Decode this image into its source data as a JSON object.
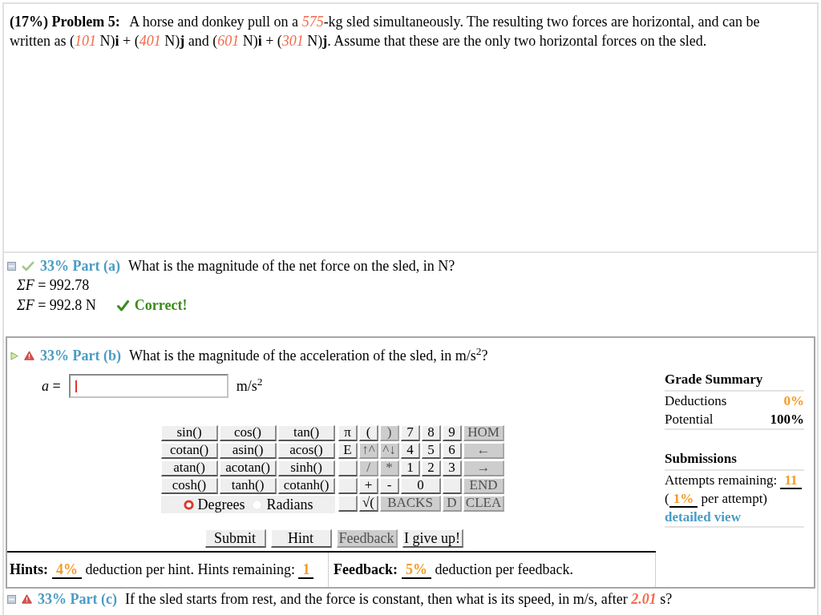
{
  "problem": {
    "statement": "**(17%) Problem 5:** A horse and donkey pull on a *575*-kg sled simultaneously. The resulting two forces are horizontal, and can be written as (*101* N)**i** + (*401* N)**j** and (*601* N)**i** + (*301* N)**j**. Assume that these are the only two horizontal forces on the sled."
  },
  "parts": [
    {
      "selected": false,
      "correct": true,
      "label": "33% Part (a)",
      "question": "What is the magnitude of the net force on the sled, in N?",
      "entered": "*ΣF* = 992.78",
      "answer": "*ΣF* = 992.8 N",
      "result": "Correct!"
    },
    {
      "selected": true,
      "correct": false,
      "label": "33% Part (b)",
      "question": "What is the magnitude of the acceleration of the sled, in m/s$^{2}$?",
      "answer_field": {
        "label": "*a* =",
        "unit": "m/s$^{2}$",
        "focused": true
      },
      "calculator": {
        "functions": [
          {
            "label": "sin()"
          },
          {
            "label": "cos()"
          },
          {
            "label": "tan()"
          },
          {
            "label": "cotan()"
          },
          {
            "label": "asin()"
          },
          {
            "label": "acos()"
          },
          {
            "label": "atan()"
          },
          {
            "label": "acotan()"
          },
          {
            "label": "sinh()"
          },
          {
            "label": "cosh()"
          },
          {
            "label": "tanh()"
          },
          {
            "label": "cotanh()"
          }
        ],
        "angle_units": [
          {
            "label": "Degrees",
            "selected": true
          },
          {
            "label": "Radians",
            "selected": false
          }
        ],
        "key_rows": [
          [
            {
              "label": "π",
              "disabled": false
            },
            {
              "label": "(",
              "disabled": false
            },
            {
              "label": ")",
              "disabled": true
            },
            {
              "label": "7",
              "disabled": false
            },
            {
              "label": "8",
              "disabled": false
            },
            {
              "label": "9",
              "disabled": false
            },
            {
              "label": "HOM",
              "disabled": true
            }
          ],
          [
            {
              "label": "E",
              "disabled": false
            },
            {
              "label": "↑^",
              "disabled": true
            },
            {
              "label": "^↓",
              "disabled": true
            },
            {
              "label": "4",
              "disabled": false
            },
            {
              "label": "5",
              "disabled": false
            },
            {
              "label": "6",
              "disabled": false
            },
            {
              "label": "←",
              "disabled": true
            }
          ],
          [
            {
              "disabled": false
            },
            {
              "label": "/",
              "disabled": true
            },
            {
              "label": "*",
              "disabled": true
            },
            {
              "label": "1",
              "disabled": false
            },
            {
              "label": "2",
              "disabled": false
            },
            {
              "label": "3",
              "disabled": false
            },
            {
              "label": "→",
              "disabled": true
            }
          ],
          [
            {
              "disabled": false
            },
            {
              "label": "+",
              "disabled": false
            },
            {
              "label": "-",
              "disabled": false
            },
            {
              "label": "0",
              "disabled": false
            },
            {
              "disabled": false
            },
            {
              "label": "END",
              "disabled": true
            }
          ],
          [
            {
              "disabled": false
            },
            {
              "label": "√(",
              "disabled": false
            },
            {
              "label": "BACKS",
              "disabled": true
            },
            {
              "label": "D",
              "disabled": true
            },
            {
              "label": "CLEA",
              "disabled": true
            }
          ]
        ]
      },
      "actions": [
        {
          "label": "Submit",
          "disabled": false
        },
        {
          "label": "Hint",
          "disabled": false
        },
        {
          "label": "Feedback",
          "disabled": true
        },
        {
          "label": "I give up!",
          "disabled": false
        }
      ],
      "hints": {
        "hint_label": "Hints:",
        "hint_text": "**4%** deduction per hint. Hints remaining: **1**",
        "feedback_label": "Feedback:",
        "feedback_text": "**5%** deduction per feedback."
      },
      "grade_summary": {
        "title": "Grade Summary",
        "rows": [
          {
            "label": "Deductions",
            "value": "0%",
            "kind": "deduction"
          },
          {
            "label": "Potential",
            "value": "100%",
            "kind": "total"
          }
        ]
      },
      "submissions": {
        "title": "Submissions",
        "attempts": "Attempts remaining: **11**",
        "cost": "(**1%** per attempt)",
        "link": "detailed view"
      }
    },
    {
      "selected": false,
      "correct": false,
      "label": "33% Part (c)",
      "question": "If the sled starts from rest, and the force is constant, then what is its speed, in m/s, after *2.01* s?"
    }
  ]
}
